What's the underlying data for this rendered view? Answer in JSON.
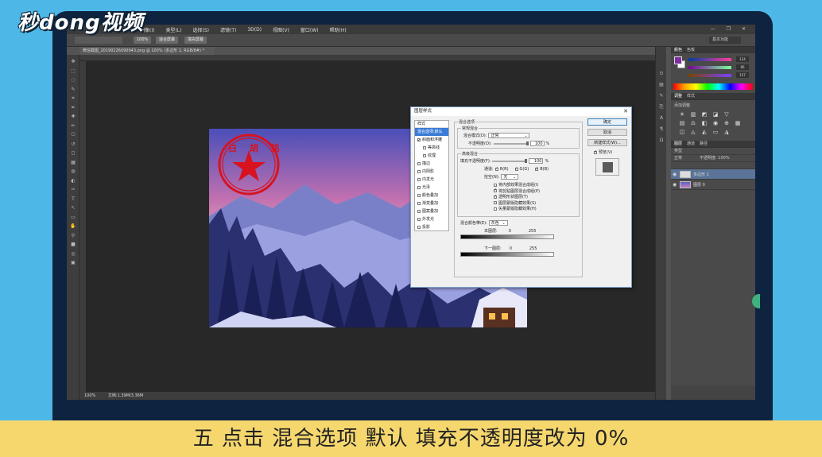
{
  "watermark": "秒dong视频",
  "menu": [
    "图像(I)",
    "类型(L)",
    "选择(S)",
    "滤镜(T)",
    "3D(D)",
    "视图(V)",
    "窗口(W)",
    "帮助(H)"
  ],
  "options_bar": {
    "zoom_btn": "100%",
    "fit_btn": "适合屏幕",
    "fill_btn": "填充屏幕",
    "workspace": "基本功能"
  },
  "document_tab": "微信截图_20190226090943.png @ 100% (多边形 1, RGB/8#) *",
  "status": {
    "zoom": "100%",
    "doc": "文档:1.39M/3.36M"
  },
  "stamp_text": "白 胡 铭",
  "dialog": {
    "title": "图层样式",
    "close": "✕",
    "styles_header": "样式",
    "style_items": [
      {
        "label": "混合选项:默认",
        "checked": false,
        "selected": true,
        "sub": false
      },
      {
        "label": "斜面和浮雕",
        "checked": true,
        "selected": false,
        "sub": false
      },
      {
        "label": "等高线",
        "checked": false,
        "selected": false,
        "sub": true
      },
      {
        "label": "纹理",
        "checked": false,
        "selected": false,
        "sub": true
      },
      {
        "label": "描边",
        "checked": false,
        "selected": false,
        "sub": false
      },
      {
        "label": "内阴影",
        "checked": false,
        "selected": false,
        "sub": false
      },
      {
        "label": "内发光",
        "checked": false,
        "selected": false,
        "sub": false
      },
      {
        "label": "光泽",
        "checked": false,
        "selected": false,
        "sub": false
      },
      {
        "label": "颜色叠加",
        "checked": false,
        "selected": false,
        "sub": false
      },
      {
        "label": "渐变叠加",
        "checked": false,
        "selected": false,
        "sub": false
      },
      {
        "label": "图案叠加",
        "checked": false,
        "selected": false,
        "sub": false
      },
      {
        "label": "外发光",
        "checked": false,
        "selected": false,
        "sub": false
      },
      {
        "label": "投影",
        "checked": false,
        "selected": false,
        "sub": false
      }
    ],
    "blend_options_title": "混合选项",
    "general_blend": "常规混合",
    "blend_mode_label": "混合模式(D):",
    "blend_mode_value": "正常",
    "opacity_label": "不透明度(O):",
    "opacity_value": "100",
    "percent": "%",
    "advanced_blend": "高级混合",
    "fill_opacity_label": "填充不透明度(F):",
    "fill_opacity_value": "100",
    "channels_label": "通道:",
    "channel_r": "R(R)",
    "channel_g": "G(G)",
    "channel_b": "B(B)",
    "knockout_label": "挖空(N):",
    "knockout_value": "无",
    "options": [
      {
        "label": "将内部效果混合成组(I)",
        "checked": false
      },
      {
        "label": "将剪贴图层混合成组(P)",
        "checked": true
      },
      {
        "label": "透明形状图层(T)",
        "checked": true
      },
      {
        "label": "图层蒙版隐藏效果(S)",
        "checked": false
      },
      {
        "label": "矢量蒙版隐藏效果(H)",
        "checked": false
      }
    ],
    "blend_if_label": "混合颜色带(E):",
    "blend_if_value": "灰色",
    "this_layer": "本图层:",
    "underlying": "下一图层:",
    "v0": "0",
    "v255": "255",
    "ok": "确定",
    "cancel": "取消",
    "new_style": "新建样式(W)...",
    "preview": "预览(V)"
  },
  "panels": {
    "color_tabs": [
      "颜色",
      "色板"
    ],
    "color_values": [
      "124",
      "66",
      "157"
    ],
    "adj_tabs": [
      "调整",
      "样式"
    ],
    "adj_add": "添加调整",
    "layers_tabs": [
      "图层",
      "通道",
      "路径"
    ],
    "kind": "类型",
    "blend": "正常",
    "opacity": "不透明度: 100%",
    "layers": [
      {
        "name": "多边形 1",
        "selected": true
      },
      {
        "name": "图层 0",
        "selected": false
      }
    ]
  },
  "subtitle": "五  点击  混合选项  默认  填充不透明度改为  0%",
  "colors": {
    "accent": "#3a7bd5",
    "stamp": "#d8121f",
    "subtitle_bg": "#f5d76e",
    "frame": "#0e2340",
    "page_bg": "#4db8e8"
  }
}
